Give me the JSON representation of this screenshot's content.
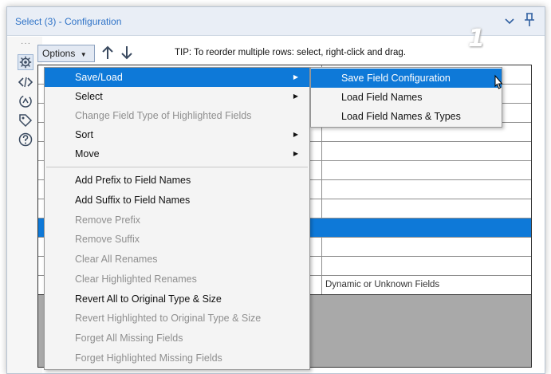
{
  "window": {
    "title": "Select (3) - Configuration",
    "annotation_badge": "1"
  },
  "toolbar": {
    "options_label": "Options",
    "tip": "TIP: To reorder multiple rows: select, right-click and drag."
  },
  "grid": {
    "last_row_text": "Dynamic or Unknown Fields"
  },
  "menu": {
    "items": [
      {
        "label": "Save/Load",
        "has_submenu": true,
        "enabled": true,
        "highlighted": true
      },
      {
        "label": "Select",
        "has_submenu": true,
        "enabled": true
      },
      {
        "label": "Change Field Type of Highlighted Fields",
        "enabled": false
      },
      {
        "label": "Sort",
        "has_submenu": true,
        "enabled": true
      },
      {
        "label": "Move",
        "has_submenu": true,
        "enabled": true
      },
      {
        "label": "Add Prefix to Field Names",
        "enabled": true
      },
      {
        "label": "Add Suffix to Field Names",
        "enabled": true
      },
      {
        "label": "Remove Prefix",
        "enabled": false
      },
      {
        "label": "Remove Suffix",
        "enabled": false
      },
      {
        "label": "Clear All Renames",
        "enabled": false
      },
      {
        "label": "Clear Highlighted Renames",
        "enabled": false
      },
      {
        "label": "Revert All to Original Type & Size",
        "enabled": true
      },
      {
        "label": "Revert Highlighted to Original Type & Size",
        "enabled": false
      },
      {
        "label": "Forget All Missing Fields",
        "enabled": false
      },
      {
        "label": "Forget Highlighted Missing Fields",
        "enabled": false
      }
    ]
  },
  "submenu": {
    "items": [
      {
        "label": "Save Field Configuration",
        "highlighted": true
      },
      {
        "label": "Load Field Names"
      },
      {
        "label": "Load Field Names & Types"
      }
    ]
  },
  "colors": {
    "highlight": "#0e79d8",
    "title_text": "#2f73c7",
    "disabled_text": "#8f8f8f"
  },
  "icons": {
    "sidebar": [
      "configuration-gear-icon",
      "code-icon",
      "annotation-icon",
      "tag-icon",
      "help-icon"
    ],
    "toolbar": [
      "move-up-arrow-icon",
      "move-down-arrow-icon"
    ],
    "titlebar": [
      "chevron-down-icon",
      "pin-icon"
    ]
  }
}
